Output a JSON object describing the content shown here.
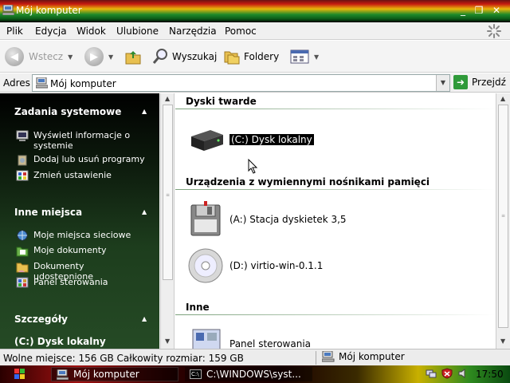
{
  "window": {
    "title": "Mój komputer",
    "controls": {
      "minimize": "_",
      "maximize": "❐",
      "close": "✕"
    }
  },
  "menu": [
    "Plik",
    "Edycja",
    "Widok",
    "Ulubione",
    "Narzędzia",
    "Pomoc"
  ],
  "toolbar": {
    "back": "Wstecz",
    "search": "Wyszukaj",
    "folders": "Foldery"
  },
  "address": {
    "label": "Adres",
    "value": "Mój komputer",
    "go": "Przejdź"
  },
  "sidebar": {
    "sections": [
      {
        "title": "Zadania systemowe",
        "items": [
          {
            "label": "Wyświetl informacje o systemie",
            "icon": "system-info-icon"
          },
          {
            "label": "Dodaj lub usuń programy",
            "icon": "add-remove-programs-icon"
          },
          {
            "label": "Zmień ustawienie",
            "icon": "change-setting-icon"
          }
        ]
      },
      {
        "title": "Inne miejsca",
        "items": [
          {
            "label": "Moje miejsca sieciowe",
            "icon": "network-places-icon"
          },
          {
            "label": "Moje dokumenty",
            "icon": "my-documents-icon"
          },
          {
            "label": "Dokumenty udostępnione",
            "icon": "shared-documents-icon"
          },
          {
            "label": "Panel sterowania",
            "icon": "control-panel-icon"
          }
        ]
      },
      {
        "title": "Szczegóły",
        "items": [
          {
            "label": "(C:) Dysk lokalny"
          }
        ]
      }
    ]
  },
  "content": {
    "groups": [
      {
        "title": "Dyski twarde",
        "items": [
          {
            "label": "(C:) Dysk lokalny",
            "icon": "hard-drive-icon",
            "selected": true
          }
        ]
      },
      {
        "title": "Urządzenia z wymiennymi nośnikami pamięci",
        "items": [
          {
            "label": "(A:) Stacja dyskietek 3,5",
            "icon": "floppy-drive-icon"
          },
          {
            "label": "(D:) virtio-win-0.1.1",
            "icon": "cd-drive-icon"
          }
        ]
      },
      {
        "title": "Inne",
        "items": [
          {
            "label": "Panel sterowania",
            "icon": "control-panel-icon"
          }
        ]
      }
    ]
  },
  "status": {
    "left": "Wolne miejsce: 156 GB Całkowity rozmiar: 159 GB",
    "right": "Mój komputer"
  },
  "taskbar": {
    "tasks": [
      {
        "label": "Mój komputer"
      },
      {
        "label": "C:\\WINDOWS\\syst..."
      }
    ],
    "clock": "17:50"
  },
  "colors": {
    "selection": "#000000",
    "sidebar_bg": "#1d3d1d"
  }
}
